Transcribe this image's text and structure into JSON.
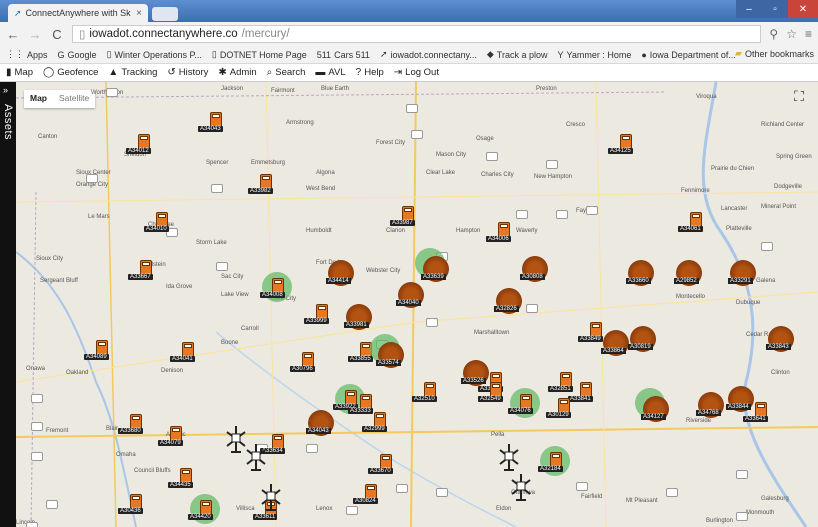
{
  "browser": {
    "tab_title": "ConnectAnywhere with Sk",
    "tab_close": "×",
    "url_host": "iowadot.connectanywhere.co",
    "url_path": "/mercury/",
    "bookmarks": [
      {
        "icon": "apps-icon",
        "glyph": "⋮⋮",
        "label": "Apps"
      },
      {
        "icon": "google-icon",
        "glyph": "G",
        "label": "Google"
      },
      {
        "icon": "page-icon",
        "glyph": "▯",
        "label": "Winter Operations P..."
      },
      {
        "icon": "page-icon",
        "glyph": "▯",
        "label": "DOTNET Home Page"
      },
      {
        "icon": "511-icon",
        "glyph": "511",
        "label": "Cars 511"
      },
      {
        "icon": "connectanywhere-icon",
        "glyph": "➚",
        "label": "iowadot.connectany..."
      },
      {
        "icon": "plow-icon",
        "glyph": "◆",
        "label": "Track a plow"
      },
      {
        "icon": "yammer-icon",
        "glyph": "Y",
        "label": "Yammer : Home"
      },
      {
        "icon": "iowa-icon",
        "glyph": "●",
        "label": "Iowa Department of..."
      }
    ],
    "other_bookmarks": "Other bookmarks"
  },
  "toolbar": {
    "items": [
      {
        "icon": "map-icon",
        "glyph": "▮",
        "label": "Map"
      },
      {
        "icon": "geofence-icon",
        "glyph": "◯",
        "label": "Geofence"
      },
      {
        "icon": "tracking-icon",
        "glyph": "▲",
        "label": "Tracking"
      },
      {
        "icon": "history-icon",
        "glyph": "↺",
        "label": "History"
      },
      {
        "icon": "admin-icon",
        "glyph": "✱",
        "label": "Admin"
      },
      {
        "icon": "search-icon",
        "glyph": "⌕",
        "label": "Search"
      },
      {
        "icon": "avl-icon",
        "glyph": "▬",
        "label": "AVL"
      },
      {
        "icon": "help-icon",
        "glyph": "?",
        "label": "Help"
      },
      {
        "icon": "logout-icon",
        "glyph": "⇥",
        "label": "Log Out"
      }
    ]
  },
  "sidebar": {
    "label": "Assets",
    "toggle": "»"
  },
  "map": {
    "type_map": "Map",
    "type_satellite": "Satellite",
    "towns": [
      "Worthington",
      "Jackson",
      "Fairmont",
      "Blue Earth",
      "Preston",
      "Viroqua",
      "Richland Center",
      "Canton",
      "Spencer",
      "Armstrong",
      "Forest City",
      "Osage",
      "Cresco",
      "Spring Green",
      "Sheldon",
      "Emmetsburg",
      "Mason City",
      "Charles City",
      "New Hampton",
      "Prairie du Chien",
      "Dodgeville",
      "Sioux Center",
      "Orange City",
      "Algona",
      "Clear Lake",
      "Fennimore",
      "West Bend",
      "Lancaster",
      "Mineral Point",
      "Le Mars",
      "Cherokee",
      "Humboldt",
      "Clarion",
      "Hampton",
      "Waverly",
      "Fayette",
      "Platteville",
      "Storm Lake",
      "Sioux City",
      "Holstein",
      "Fort Dodge",
      "Webster City",
      "Galena",
      "Sergeant Bluff",
      "Sac City",
      "Ida Grove",
      "Lake View",
      "Lake City",
      "Dubuque",
      "Montecello",
      "Carroll",
      "Boone",
      "Marshalltown",
      "Cedar Rapids",
      "Denison",
      "Clinton",
      "Onawa",
      "Fremont",
      "Blair",
      "Omaha",
      "Council Bluffs",
      "Atlantic",
      "Villisca",
      "Lenox",
      "Ottumwa",
      "Fairfield",
      "Mt Pleasant",
      "Eldon",
      "Galesburg",
      "Monmouth",
      "Burlington",
      "Lincoln",
      "Pella",
      "Riverside",
      "Oakland"
    ],
    "units": [
      "A34043",
      "A34012",
      "A33982",
      "A33987",
      "A33981",
      "A34010",
      "A34006",
      "A34061",
      "A34125",
      "A33667",
      "A34008",
      "A34414",
      "A33639",
      "A34040",
      "A33999",
      "A30808",
      "A29852",
      "A33291",
      "A33660",
      "A32826",
      "A33849",
      "A33841",
      "A34089",
      "A34041",
      "A33855",
      "A33574",
      "A33526",
      "A30796",
      "A33573",
      "A33864",
      "A32851",
      "A30819",
      "A33843",
      "A33922",
      "A33844",
      "A33680",
      "A34079",
      "A33670",
      "A32999",
      "A34076",
      "A34043",
      "A34127",
      "A34768",
      "A33641",
      "A30129",
      "A32549",
      "A32510",
      "A33333",
      "A34435",
      "A33634",
      "A34420",
      "A30824",
      "A30436",
      "A32184",
      "A33611"
    ]
  }
}
